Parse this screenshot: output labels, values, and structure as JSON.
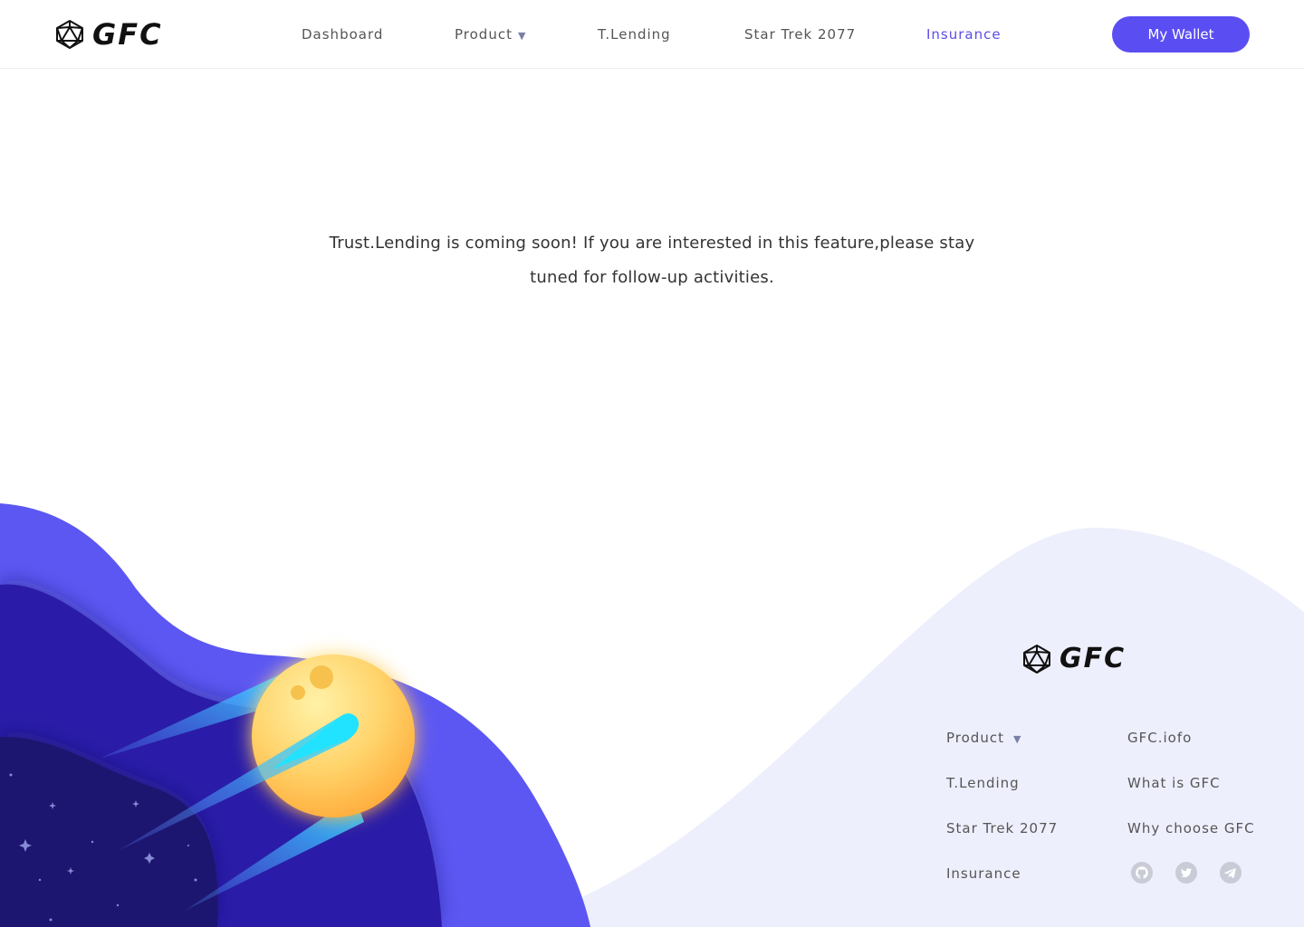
{
  "brand": {
    "name": "GFC"
  },
  "nav": {
    "items": [
      {
        "label": "Dashboard"
      },
      {
        "label": "Product",
        "caret": "▼"
      },
      {
        "label": "T.Lending"
      },
      {
        "label": "Star Trek 2077"
      },
      {
        "label": "Insurance",
        "active": true
      }
    ],
    "wallet_label": "My Wallet"
  },
  "message": {
    "line1": "Trust.Lending is coming soon!  If you are interested in this feature,please stay",
    "line2": "tuned for follow-up activities."
  },
  "footer": {
    "brand": "GFC",
    "col1": [
      {
        "label": "Product",
        "caret": "▼"
      },
      {
        "label": "T.Lending"
      },
      {
        "label": "Star Trek 2077"
      },
      {
        "label": "Insurance"
      }
    ],
    "col2": [
      {
        "label": "GFC.iofo"
      },
      {
        "label": "What is GFC"
      },
      {
        "label": "Why choose GFC"
      }
    ],
    "social": [
      "github-icon",
      "twitter-icon",
      "telegram-icon"
    ]
  },
  "colors": {
    "accent": "#5a4df2",
    "active_nav": "#5b4de6",
    "wave_light": "#eeeffc",
    "planet_yellow": "#ffd36a",
    "comet_cyan": "#21e3ff"
  }
}
